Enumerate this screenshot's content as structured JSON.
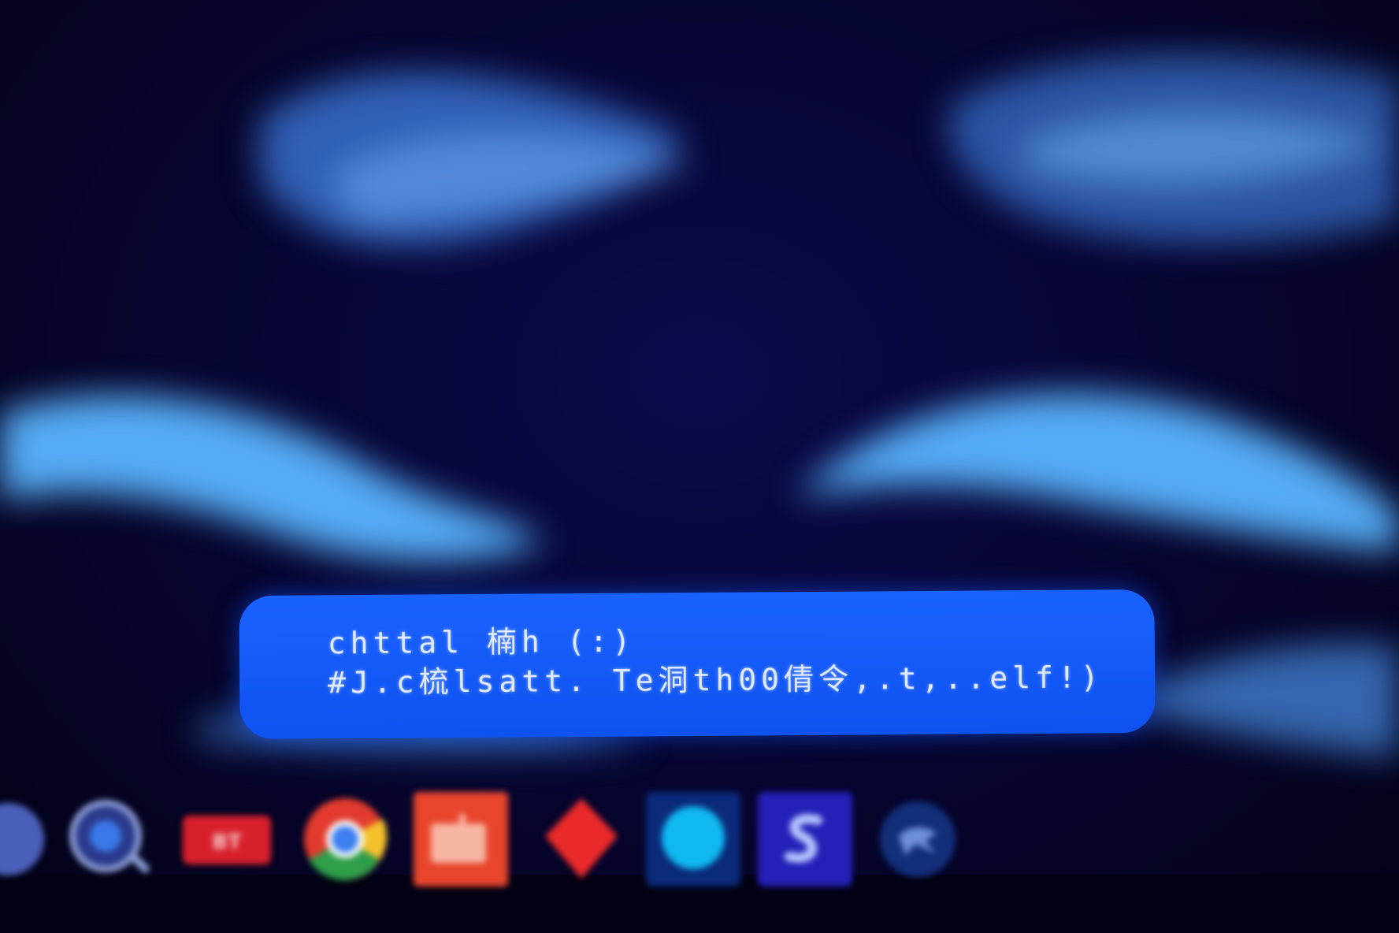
{
  "notification": {
    "line1": "chttal 楠h (:)",
    "line2": "#J.c梳lsatt. Te洞th00倩令,.t,..elf!)"
  },
  "dock": {
    "items": [
      {
        "icon": "partial-circle-icon"
      },
      {
        "icon": "phone-search-icon"
      },
      {
        "icon": "red-label-icon",
        "label": "BT"
      },
      {
        "icon": "chrome-icon"
      },
      {
        "icon": "orange-folder-icon"
      },
      {
        "icon": "red-diamond-icon"
      },
      {
        "icon": "cyan-circle-icon"
      },
      {
        "icon": "blue-s-icon"
      },
      {
        "icon": "blue-bird-icon"
      }
    ]
  },
  "colors": {
    "background": "#06052e",
    "waves": "#5ab4ff",
    "notification": "#1a62ff",
    "notification_text": "#dfe9ff"
  }
}
